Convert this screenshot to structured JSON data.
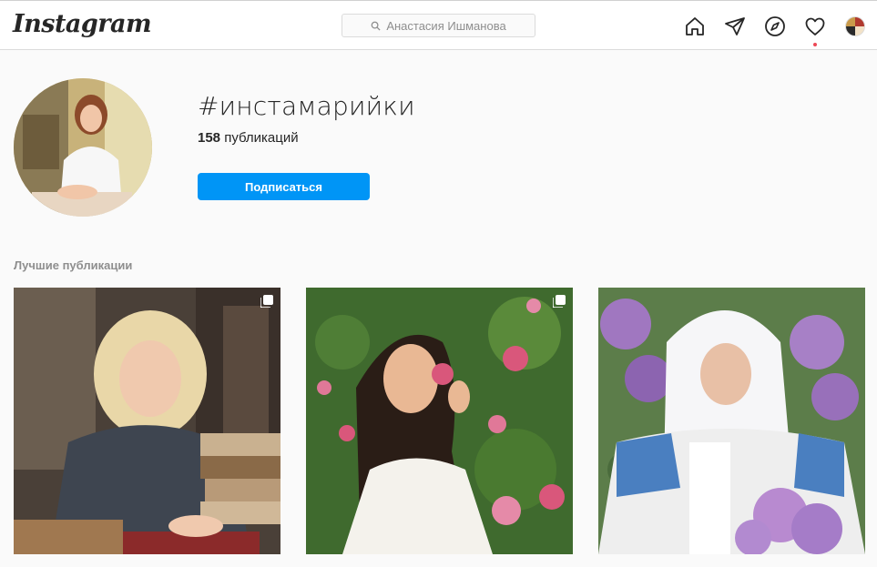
{
  "header": {
    "logo_text": "Instagram",
    "search_placeholder": "Анастасия Ишманова",
    "nav_icons": [
      "home-icon",
      "direct-icon",
      "explore-icon",
      "heart-icon",
      "profile-avatar"
    ],
    "notification_dot_color": "#ed4956"
  },
  "tag": {
    "name": "#инстамарийки",
    "posts_count": "158",
    "posts_label": " публикаций",
    "follow_label": "Подписаться",
    "follow_color": "#0095f6"
  },
  "top_posts": {
    "title": "Лучшие публикации",
    "items": [
      {
        "description": "woman-with-books",
        "multiple": true
      },
      {
        "description": "woman-smelling-roses",
        "multiple": true
      },
      {
        "description": "woman-in-headscarf-with-lilacs",
        "multiple": false
      }
    ]
  }
}
